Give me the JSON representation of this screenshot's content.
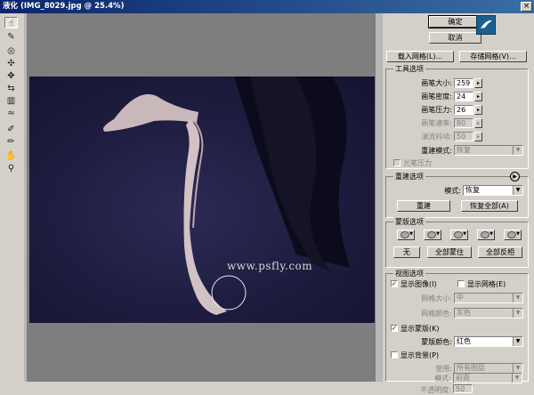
{
  "window": {
    "title": "液化 (IMG_8029.jpg @ 25.4%)",
    "close_glyph": "×"
  },
  "tools": [
    "warp-tool",
    "reconstruct-tool",
    "twirl-clockwise-tool",
    "pucker-tool",
    "bloat-tool",
    "push-left-tool",
    "mirror-tool",
    "turbulence-tool",
    "freeze-mask-tool",
    "thaw-mask-tool",
    "hand-tool",
    "zoom-tool"
  ],
  "canvas": {
    "watermark": "www.psfly.com"
  },
  "buttons": {
    "ok": "确定",
    "cancel": "取消",
    "load_mesh": "载入网格(L)...",
    "save_mesh": "存储网格(V)..."
  },
  "tool_options": {
    "title": "工具选项",
    "brush_size": {
      "label": "画笔大小:",
      "value": "259"
    },
    "brush_density": {
      "label": "画笔密度:",
      "value": "24"
    },
    "brush_pressure": {
      "label": "画笔压力:",
      "value": "26"
    },
    "brush_rate": {
      "label": "画笔速率:",
      "value": "80"
    },
    "turbulent_jitter": {
      "label": "湍流抖动:",
      "value": "50"
    },
    "reconstruct_mode": {
      "label": "重建模式:",
      "value": "恢复"
    },
    "stylus_pressure": "光笔压力"
  },
  "reconstruct_options": {
    "title": "重建选项",
    "mode_label": "模式:",
    "mode_value": "恢复",
    "reconstruct": "重建",
    "restore_all": "恢复全部(A)"
  },
  "mask_options": {
    "title": "蒙版选项",
    "none": "无",
    "mask_all": "全部蒙住",
    "invert_all": "全部反相"
  },
  "view_options": {
    "title": "视图选项",
    "show_image": "显示图像(I)",
    "show_mesh": "显示网格(E)",
    "mesh_size": {
      "label": "网格大小:",
      "value": "中"
    },
    "mesh_color": {
      "label": "网格颜色:",
      "value": "灰色"
    },
    "show_mask": "显示蒙版(K)",
    "mask_color": {
      "label": "蒙版颜色:",
      "value": "红色"
    },
    "show_backdrop": "显示背景(P)",
    "use": {
      "label": "使用:",
      "value": "所有图层"
    },
    "mode": {
      "label": "模式:",
      "value": "前面"
    },
    "opacity": {
      "label": "不透明度:",
      "value": "50"
    }
  }
}
